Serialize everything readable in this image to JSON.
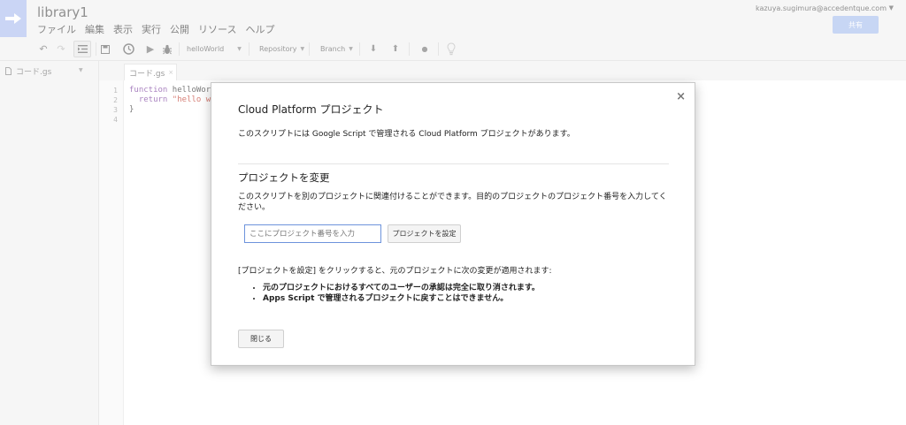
{
  "app": {
    "doc_title": "library1"
  },
  "menu": [
    "ファイル",
    "編集",
    "表示",
    "実行",
    "公開",
    "リソース",
    "ヘルプ"
  ],
  "user": {
    "email": "kazuya.sugimura@accedentque.com",
    "share_label": "共有"
  },
  "toolbar": {
    "function_select": "helloWorld",
    "repository_label": "Repository",
    "branch_label": "Branch"
  },
  "sidebar": {
    "file_name": "コード.gs"
  },
  "editor": {
    "tab_name": "コード.gs",
    "line_numbers": [
      "1",
      "2",
      "3",
      "4"
    ],
    "line1_kw": "function",
    "line1_rest": " helloWorl",
    "line2_kw": "  return",
    "line2_str": " \"hello wo",
    "line3": "}"
  },
  "dialog": {
    "title": "Cloud Platform プロジェクト",
    "description": "このスクリプトには Google Script で管理される Cloud Platform プロジェクトがあります。",
    "section_title": "プロジェクトを変更",
    "section_text": "このスクリプトを別のプロジェクトに関連付けることができます。目的のプロジェクトのプロジェクト番号を入力してください。",
    "input_placeholder": "ここにプロジェクト番号を入力",
    "set_button": "プロジェクトを設定",
    "note": "[プロジェクトを設定] をクリックすると、元のプロジェクトに次の変更が適用されます:",
    "bullets": [
      "元のプロジェクトにおけるすべてのユーザーの承認は完全に取り消されます。",
      "Apps Script で管理されるプロジェクトに戻すことはできません。"
    ],
    "close_button": "閉じる",
    "close_x": "×"
  }
}
